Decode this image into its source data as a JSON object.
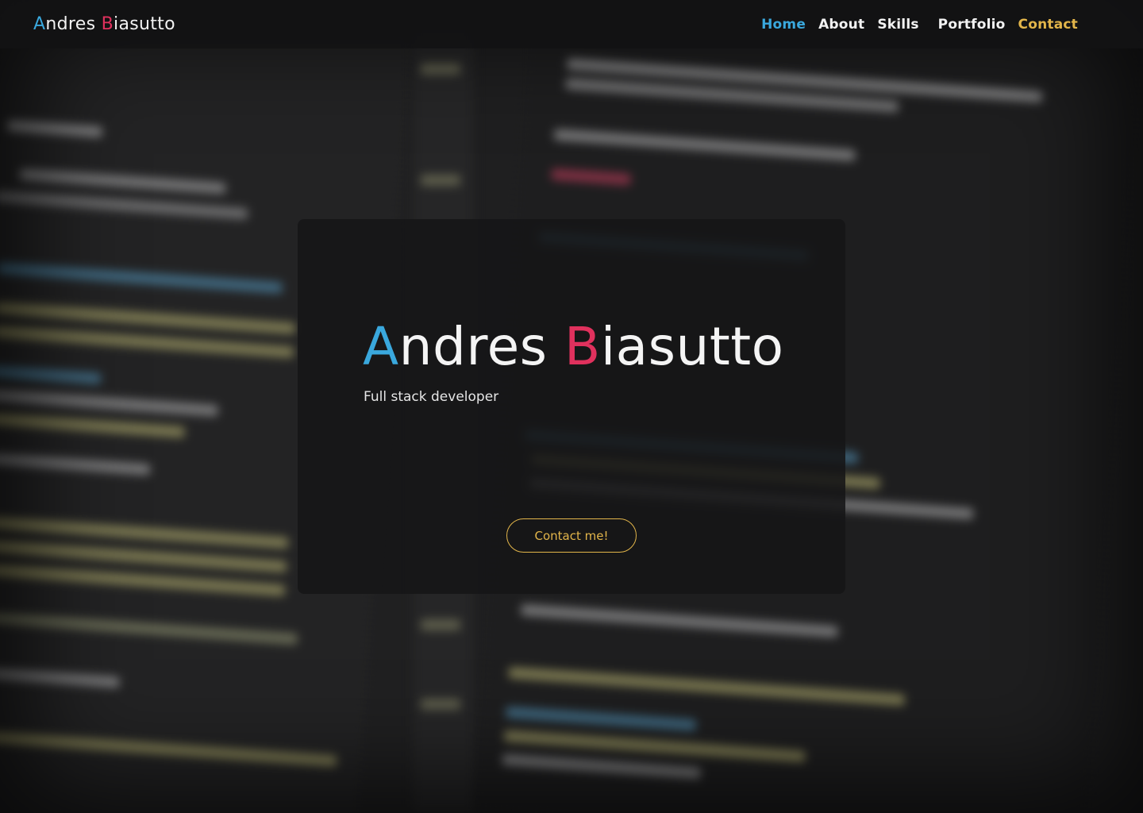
{
  "colors": {
    "accent_blue": "#3aa8dd",
    "accent_pink": "#e0315d",
    "accent_gold": "#e2b54a",
    "background": "#1b1b1c"
  },
  "navbar": {
    "brand": {
      "first_initial": "A",
      "first_rest": "ndres ",
      "last_initial": "B",
      "last_rest": "iasutto"
    },
    "links": {
      "home": "Home",
      "about": "About",
      "skills": "Skills",
      "portfolio": "Portfolio",
      "contact": "Contact"
    }
  },
  "hero": {
    "title": {
      "first_initial": "A",
      "first_rest": "ndres ",
      "last_initial": "B",
      "last_rest": "iasutto"
    },
    "subtitle": "Full stack developer",
    "cta_label": "Contact me!"
  }
}
